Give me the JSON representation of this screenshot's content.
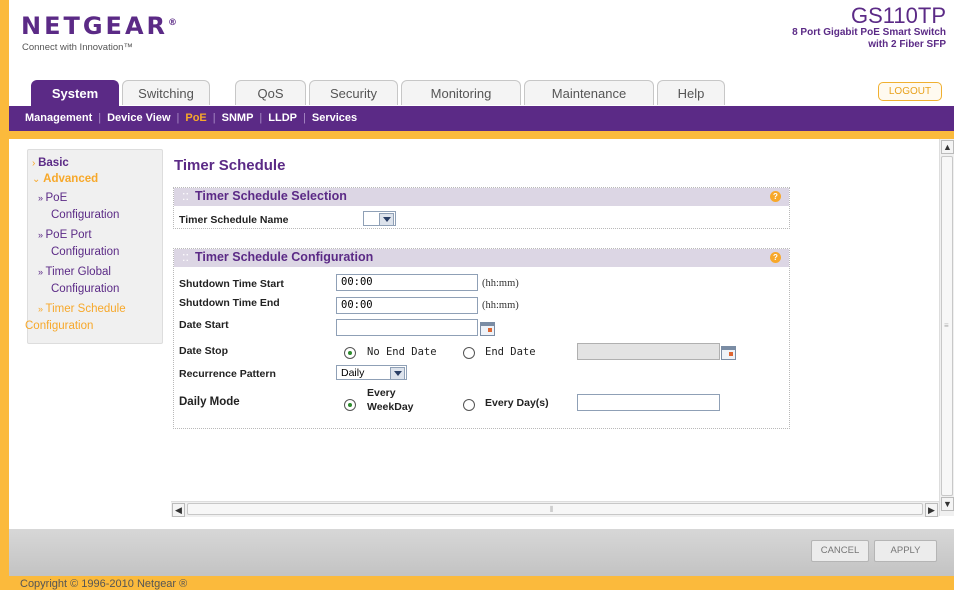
{
  "brand": {
    "logo": "NETGEAR",
    "logo_mark": "®",
    "tagline": "Connect with Innovation™"
  },
  "product": {
    "model": "GS110TP",
    "line1": "8 Port Gigabit PoE Smart Switch",
    "line2": "with 2 Fiber SFP"
  },
  "tabs": [
    {
      "label": "System"
    },
    {
      "label": "Switching"
    },
    {
      "label": "QoS"
    },
    {
      "label": "Security"
    },
    {
      "label": "Monitoring"
    },
    {
      "label": "Maintenance"
    },
    {
      "label": "Help"
    }
  ],
  "logout_label": "LOGOUT",
  "subnav": [
    {
      "label": "Management"
    },
    {
      "label": "Device View"
    },
    {
      "label": "PoE"
    },
    {
      "label": "SNMP"
    },
    {
      "label": "LLDP"
    },
    {
      "label": "Services"
    }
  ],
  "subnav_separator": "|",
  "leftnav": {
    "basic": "Basic",
    "advanced": "Advanced",
    "items": [
      {
        "line1": "PoE",
        "line2": "Configuration"
      },
      {
        "line1": "PoE Port",
        "line2": "Configuration"
      },
      {
        "line1": "Timer Global",
        "line2": "Configuration"
      },
      {
        "line1": "Timer Schedule",
        "line2": "Configuration"
      }
    ]
  },
  "page_title": "Timer Schedule",
  "selection_panel": {
    "title": "Timer Schedule Selection",
    "name_label": "Timer Schedule Name",
    "name_value": ""
  },
  "config_panel": {
    "title": "Timer Schedule Configuration",
    "shutdown_start_label": "Shutdown Time Start",
    "shutdown_start_value": "00:00",
    "shutdown_end_label": "Shutdown Time End",
    "shutdown_end_value": "00:00",
    "time_unit": "(hh:mm)",
    "date_start_label": "Date Start",
    "date_start_value": "",
    "date_stop_label": "Date Stop",
    "no_end_date_label": "No End Date",
    "end_date_label": "End Date",
    "end_date_value": "",
    "recurrence_label": "Recurrence Pattern",
    "recurrence_value": "Daily",
    "daily_mode_label": "Daily Mode",
    "every_weekday_line1": "Every",
    "every_weekday_line2": "WeekDay",
    "every_days_label": "Every Day(s)",
    "every_days_value": ""
  },
  "help_glyph": "?",
  "buttons": {
    "cancel": "CANCEL",
    "apply": "APPLY"
  },
  "copyright": "Copyright © 1996-2010 Netgear ®",
  "colors": {
    "brand_purple": "#5b2a86",
    "accent_orange": "#f7a82a",
    "background_orange": "#fbba3c"
  }
}
